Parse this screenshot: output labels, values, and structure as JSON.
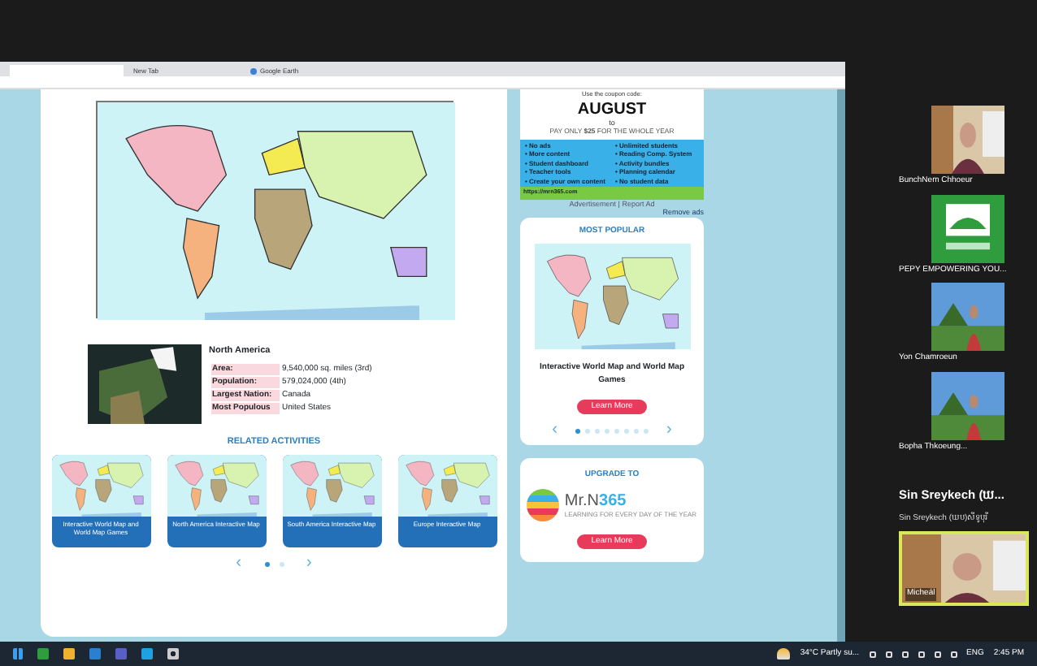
{
  "browser": {
    "tabs": [
      {
        "label": "New Tab",
        "selected": false,
        "kind": "plain"
      },
      {
        "label": "Google Earth",
        "selected": false,
        "kind": "earth"
      }
    ]
  },
  "page": {
    "region": {
      "title": "North America",
      "facts": [
        {
          "label": "Area:",
          "value": "9,540,000 sq. miles (3rd)"
        },
        {
          "label": "Population:",
          "value": "579,024,000 (4th)"
        },
        {
          "label": "Largest Nation:",
          "value": "Canada"
        },
        {
          "label": "Most Populous",
          "value": "United States"
        }
      ]
    },
    "related": {
      "title": "RELATED ACTIVITIES",
      "items": [
        {
          "label": "Interactive World Map and World Map Games"
        },
        {
          "label": "North America Interactive Map"
        },
        {
          "label": "South America Interactive Map"
        },
        {
          "label": "Europe Interactive Map"
        }
      ],
      "prev": "‹",
      "next": "›",
      "dots": [
        {
          "selected": true
        },
        {
          "selected": false
        }
      ]
    }
  },
  "sidebar": {
    "coupon": {
      "intro": "Use the coupon code:",
      "code": "AUGUST",
      "to": "to",
      "offer": "PAY ONLY **$25** FOR THE WHOLE YEAR"
    },
    "bullet": "•",
    "features_left": [
      "No ads",
      "More content",
      "Student dashboard",
      "Teacher tools",
      "Create your own content"
    ],
    "features_right": [
      "Unlimited students",
      "Reading Comp. System",
      "Activity bundles",
      "Planning calendar",
      "No student data"
    ],
    "link": "https://mrn365.com",
    "ad_note": "Advertisement | Report Ad",
    "remove_ads": "Remove ads",
    "popular": {
      "title": "MOST POPULAR",
      "item": "Interactive World Map and World Map Games",
      "button": "Learn More",
      "prev": "‹",
      "next": "›",
      "dots": [
        {
          "selected": true
        },
        {
          "selected": false
        },
        {
          "selected": false
        },
        {
          "selected": false
        },
        {
          "selected": false
        },
        {
          "selected": false
        },
        {
          "selected": false
        },
        {
          "selected": false
        }
      ]
    },
    "upgrade": {
      "title": "UPGRADE TO",
      "brand": "Mr.N",
      "brand_number": "365",
      "tagline": "LEARNING FOR EVERY DAY OF THE YEAR",
      "button": "Learn More"
    }
  },
  "participants": [
    {
      "name": "BunchNem Chhoeur",
      "kind": "video"
    },
    {
      "name": "PEPY EMPOWERING YOU...",
      "kind": "logo"
    },
    {
      "name": "Yon Chamroeun"
    },
    {
      "name": "Bopha Thkoeung..."
    }
  ],
  "speaker": {
    "title": "Sin Sreykech (ឃ...",
    "subtitle": "Sin Sreykech (ឃប)សីទូបុរី"
  },
  "self_video": {
    "name": "Micheál",
    "speaking": true
  },
  "taskbar": {
    "weather": "34°C  Partly su...",
    "language": "ENG",
    "time": "2:45 PM"
  }
}
